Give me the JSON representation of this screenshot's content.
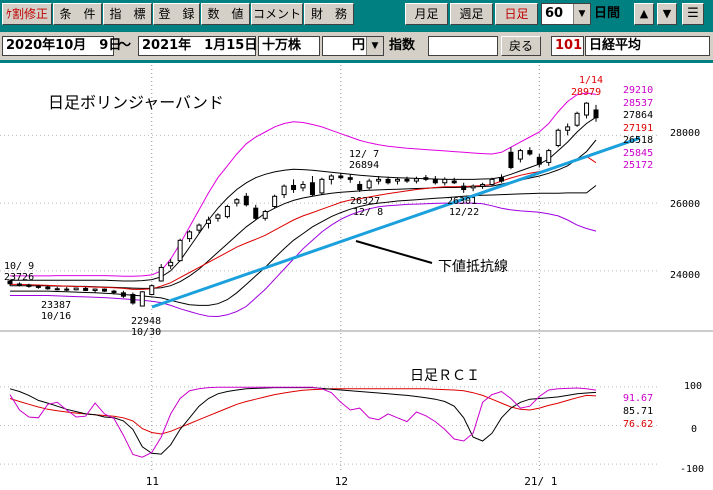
{
  "toolbar": {
    "buttons": [
      "ｹ割修正",
      "条　件",
      "指　標",
      "登　録",
      "数　値",
      "コメント",
      "財　務",
      "月足",
      "週足",
      "日足"
    ],
    "period_value": "60",
    "period_label": "日間",
    "arrow_up": "▲",
    "arrow_down": "▼",
    "menu": "☰"
  },
  "range_bar": {
    "start_date": "2020年10月　9日",
    "tilde": "～",
    "end_date": "2021年　1月15日",
    "unit": "十万株",
    "currency": "円",
    "index_label": "指数",
    "back_button": "戻る",
    "code": "101",
    "name": "日経平均"
  },
  "colors": {
    "upper": "#e000e0",
    "lower": "#a000e0",
    "sma": "#000000",
    "ema": "#dd0000",
    "trend": "#1aa0dc",
    "rci_long": "#dd0000",
    "rci_mid": "#000000",
    "rci_short": "#cc00cc"
  },
  "chart_data": [
    {
      "type": "candlestick",
      "title": "日足ボリンジャーバンド",
      "yticks": [
        24000,
        26000,
        28000
      ],
      "ylim": [
        22400,
        29900
      ],
      "xticks": [
        {
          "label": "11",
          "index": 15
        },
        {
          "label": "12",
          "index": 35
        },
        {
          "label": "21/ 1",
          "index": 56
        }
      ],
      "candles": [
        {
          "o": 23700,
          "h": 23740,
          "l": 23560,
          "c": 23620
        },
        {
          "o": 23610,
          "h": 23660,
          "l": 23540,
          "c": 23580
        },
        {
          "o": 23580,
          "h": 23620,
          "l": 23500,
          "c": 23540
        },
        {
          "o": 23540,
          "h": 23580,
          "l": 23470,
          "c": 23510
        },
        {
          "o": 23520,
          "h": 23560,
          "l": 23440,
          "c": 23470
        },
        {
          "o": 23470,
          "h": 23520,
          "l": 23420,
          "c": 23450
        },
        {
          "o": 23460,
          "h": 23520,
          "l": 23400,
          "c": 23430
        },
        {
          "o": 23440,
          "h": 23500,
          "l": 23420,
          "c": 23490
        },
        {
          "o": 23480,
          "h": 23520,
          "l": 23400,
          "c": 23420
        },
        {
          "o": 23420,
          "h": 23480,
          "l": 23360,
          "c": 23460
        },
        {
          "o": 23460,
          "h": 23480,
          "l": 23380,
          "c": 23400
        },
        {
          "o": 23400,
          "h": 23440,
          "l": 23300,
          "c": 23360
        },
        {
          "o": 23350,
          "h": 23410,
          "l": 23200,
          "c": 23250
        },
        {
          "o": 23300,
          "h": 23360,
          "l": 23000,
          "c": 23050
        },
        {
          "o": 22960,
          "h": 23400,
          "l": 22948,
          "c": 23380
        },
        {
          "o": 23300,
          "h": 23600,
          "l": 23280,
          "c": 23560
        },
        {
          "o": 23700,
          "h": 24200,
          "l": 23680,
          "c": 24100
        },
        {
          "o": 24150,
          "h": 24350,
          "l": 24050,
          "c": 24250
        },
        {
          "o": 24300,
          "h": 24950,
          "l": 24280,
          "c": 24900
        },
        {
          "o": 24950,
          "h": 25200,
          "l": 24850,
          "c": 25150
        },
        {
          "o": 25200,
          "h": 25400,
          "l": 25100,
          "c": 25350
        },
        {
          "o": 25400,
          "h": 25600,
          "l": 25250,
          "c": 25500
        },
        {
          "o": 25550,
          "h": 25700,
          "l": 25450,
          "c": 25650
        },
        {
          "o": 25600,
          "h": 25950,
          "l": 25550,
          "c": 25900
        },
        {
          "o": 26000,
          "h": 26150,
          "l": 25900,
          "c": 26100
        },
        {
          "o": 26200,
          "h": 26300,
          "l": 25900,
          "c": 25950
        },
        {
          "o": 25850,
          "h": 25950,
          "l": 25500,
          "c": 25550
        },
        {
          "o": 25550,
          "h": 25800,
          "l": 25480,
          "c": 25750
        },
        {
          "o": 25900,
          "h": 26250,
          "l": 25850,
          "c": 26200
        },
        {
          "o": 26250,
          "h": 26550,
          "l": 26150,
          "c": 26500
        },
        {
          "o": 26520,
          "h": 26700,
          "l": 26300,
          "c": 26400
        },
        {
          "o": 26450,
          "h": 26650,
          "l": 26350,
          "c": 26550
        },
        {
          "o": 26600,
          "h": 26800,
          "l": 26200,
          "c": 26250
        },
        {
          "o": 26300,
          "h": 26750,
          "l": 26250,
          "c": 26700
        },
        {
          "o": 26700,
          "h": 26850,
          "l": 26550,
          "c": 26800
        },
        {
          "o": 26800,
          "h": 26894,
          "l": 26700,
          "c": 26750
        },
        {
          "o": 26750,
          "h": 26850,
          "l": 26600,
          "c": 26700
        },
        {
          "o": 26550,
          "h": 26650,
          "l": 26327,
          "c": 26400
        },
        {
          "o": 26450,
          "h": 26720,
          "l": 26400,
          "c": 26650
        },
        {
          "o": 26650,
          "h": 26800,
          "l": 26550,
          "c": 26700
        },
        {
          "o": 26700,
          "h": 26780,
          "l": 26550,
          "c": 26600
        },
        {
          "o": 26650,
          "h": 26750,
          "l": 26550,
          "c": 26700
        },
        {
          "o": 26700,
          "h": 26780,
          "l": 26600,
          "c": 26650
        },
        {
          "o": 26650,
          "h": 26780,
          "l": 26580,
          "c": 26720
        },
        {
          "o": 26750,
          "h": 26830,
          "l": 26650,
          "c": 26700
        },
        {
          "o": 26700,
          "h": 26800,
          "l": 26550,
          "c": 26600
        },
        {
          "o": 26600,
          "h": 26760,
          "l": 26520,
          "c": 26700
        },
        {
          "o": 26650,
          "h": 26750,
          "l": 26560,
          "c": 26600
        },
        {
          "o": 26500,
          "h": 26600,
          "l": 26301,
          "c": 26400
        },
        {
          "o": 26450,
          "h": 26550,
          "l": 26350,
          "c": 26500
        },
        {
          "o": 26500,
          "h": 26600,
          "l": 26420,
          "c": 26550
        },
        {
          "o": 26550,
          "h": 26750,
          "l": 26500,
          "c": 26700
        },
        {
          "o": 26750,
          "h": 26850,
          "l": 26600,
          "c": 26650
        },
        {
          "o": 27500,
          "h": 27650,
          "l": 27000,
          "c": 27050
        },
        {
          "o": 27300,
          "h": 27600,
          "l": 27200,
          "c": 27550
        },
        {
          "o": 27550,
          "h": 27650,
          "l": 27400,
          "c": 27450
        },
        {
          "o": 27350,
          "h": 27450,
          "l": 27050,
          "c": 27150
        },
        {
          "o": 27200,
          "h": 27600,
          "l": 27100,
          "c": 27550
        },
        {
          "o": 27700,
          "h": 28200,
          "l": 27650,
          "c": 28150
        },
        {
          "o": 28150,
          "h": 28350,
          "l": 28000,
          "c": 28250
        },
        {
          "o": 28300,
          "h": 28700,
          "l": 28250,
          "c": 28650
        },
        {
          "o": 28600,
          "h": 28979,
          "l": 28500,
          "c": 28950
        },
        {
          "o": 28750,
          "h": 28900,
          "l": 28400,
          "c": 28520
        }
      ],
      "upper_band_2s": [
        23850,
        23850,
        23850,
        23850,
        23850,
        23860,
        23860,
        23860,
        23860,
        23860,
        23860,
        23850,
        23840,
        23840,
        23850,
        23880,
        24000,
        24350,
        24800,
        25300,
        25800,
        26300,
        26750,
        27100,
        27450,
        27750,
        27950,
        28100,
        28250,
        28350,
        28400,
        28380,
        28320,
        28250,
        28150,
        28050,
        27950,
        27850,
        27780,
        27720,
        27680,
        27650,
        27620,
        27600,
        27580,
        27560,
        27540,
        27520,
        27500,
        27480,
        27460,
        27450,
        27500,
        27650,
        27800,
        27950,
        28100,
        28350,
        28700,
        29000,
        29200,
        29250,
        29210
      ],
      "upper_band_1s": [
        23720,
        23720,
        23720,
        23720,
        23720,
        23720,
        23720,
        23720,
        23720,
        23720,
        23720,
        23710,
        23700,
        23700,
        23710,
        23740,
        23820,
        24000,
        24300,
        24700,
        25100,
        25500,
        25850,
        26150,
        26400,
        26600,
        26750,
        26850,
        26920,
        26970,
        27000,
        26990,
        26970,
        26940,
        26910,
        26880,
        26850,
        26820,
        26800,
        26780,
        26760,
        26750,
        26740,
        26730,
        26720,
        26710,
        26700,
        26700,
        26700,
        26700,
        26710,
        26720,
        26760,
        26850,
        26950,
        27050,
        27150,
        27300,
        27550,
        27800,
        28100,
        28350,
        28537
      ],
      "sma": [
        23560,
        23560,
        23560,
        23560,
        23560,
        23550,
        23550,
        23540,
        23540,
        23530,
        23520,
        23510,
        23500,
        23490,
        23480,
        23480,
        23500,
        23560,
        23680,
        23850,
        24050,
        24300,
        24550,
        24800,
        25050,
        25300,
        25500,
        25700,
        25850,
        25980,
        26080,
        26150,
        26200,
        26250,
        26290,
        26320,
        26340,
        26360,
        26380,
        26390,
        26400,
        26410,
        26420,
        26430,
        26440,
        26450,
        26460,
        26460,
        26470,
        26480,
        26490,
        26500,
        26560,
        26620,
        26680,
        26740,
        26800,
        26880,
        26980,
        27100,
        27300,
        27520,
        27864
      ],
      "ema": [
        23600,
        23600,
        23590,
        23580,
        23570,
        23560,
        23550,
        23540,
        23530,
        23520,
        23510,
        23500,
        23480,
        23450,
        23450,
        23470,
        23550,
        23650,
        23800,
        23950,
        24100,
        24250,
        24400,
        24550,
        24700,
        24820,
        24930,
        25050,
        25200,
        25350,
        25500,
        25620,
        25720,
        25820,
        25920,
        26020,
        26090,
        26130,
        26180,
        26230,
        26280,
        26320,
        26360,
        26400,
        26430,
        26460,
        26480,
        26480,
        26490,
        26500,
        26520,
        26550,
        26650,
        26740,
        26820,
        26880,
        26930,
        27000,
        27080,
        27180,
        27280,
        27380,
        27191
      ],
      "lower_band_1s": [
        23400,
        23400,
        23400,
        23400,
        23400,
        23390,
        23380,
        23370,
        23360,
        23350,
        23340,
        23320,
        23300,
        23280,
        23260,
        23230,
        23200,
        23130,
        23060,
        23000,
        22980,
        22980,
        23030,
        23150,
        23350,
        23600,
        23850,
        24100,
        24380,
        24650,
        24900,
        25100,
        25300,
        25450,
        25600,
        25720,
        25820,
        25900,
        25960,
        26000,
        26030,
        26060,
        26080,
        26100,
        26120,
        26140,
        26160,
        26180,
        26200,
        26220,
        26230,
        26240,
        26250,
        26260,
        26270,
        26280,
        26290,
        26290,
        26290,
        26300,
        26300,
        26300,
        26518
      ],
      "lower_band_2s": [
        23270,
        23270,
        23270,
        23270,
        23270,
        23260,
        23250,
        23240,
        23230,
        23220,
        23210,
        23190,
        23170,
        23150,
        23130,
        23100,
        23060,
        22980,
        22880,
        22800,
        22720,
        22660,
        22650,
        22700,
        22800,
        22950,
        23200,
        23450,
        23750,
        24050,
        24350,
        24650,
        24900,
        25150,
        25350,
        25520,
        25650,
        25750,
        25830,
        25890,
        25920,
        25940,
        25960,
        25970,
        25980,
        25990,
        26000,
        26000,
        26000,
        26000,
        25980,
        25920,
        25850,
        25800,
        25770,
        25750,
        25730,
        25680,
        25620,
        25500,
        25350,
        25250,
        25172
      ]
    },
    {
      "type": "line",
      "title": "日足ＲＣＩ",
      "yticks": [
        100,
        0,
        -100
      ],
      "ylim": [
        -110,
        110
      ],
      "series": [
        {
          "values": [
            70,
            62,
            55,
            48,
            42,
            38,
            35,
            32,
            30,
            28,
            26,
            24,
            20,
            12,
            -8,
            -18,
            -22,
            -15,
            -5,
            5,
            15,
            25,
            35,
            45,
            55,
            62,
            68,
            74,
            80,
            84,
            88,
            91,
            93,
            94,
            95,
            95,
            95,
            95,
            95,
            95,
            95,
            95,
            95,
            95,
            95,
            94,
            93,
            92,
            90,
            85,
            78,
            68,
            58,
            48,
            42,
            40,
            45,
            52,
            58,
            65,
            72,
            78,
            76.62
          ]
        },
        {
          "values": [
            95,
            88,
            78,
            65,
            58,
            50,
            42,
            36,
            30,
            28,
            22,
            20,
            12,
            -10,
            -55,
            -72,
            -74,
            -50,
            -10,
            20,
            50,
            70,
            82,
            88,
            92,
            95,
            96,
            97,
            98,
            98,
            98,
            98,
            98,
            96,
            94,
            92,
            90,
            88,
            86,
            84,
            82,
            80,
            78,
            75,
            72,
            68,
            62,
            50,
            20,
            -30,
            -40,
            -20,
            20,
            45,
            60,
            68,
            70,
            72,
            74,
            78,
            82,
            84,
            85.71
          ]
        },
        {
          "values": [
            80,
            40,
            22,
            20,
            55,
            60,
            40,
            22,
            24,
            58,
            30,
            18,
            -25,
            -75,
            -82,
            -70,
            -30,
            30,
            70,
            90,
            95,
            98,
            99,
            99,
            99,
            99,
            99,
            99,
            99,
            99,
            99,
            99,
            99,
            95,
            85,
            60,
            40,
            45,
            20,
            15,
            30,
            20,
            10,
            35,
            25,
            10,
            -10,
            -35,
            -40,
            -20,
            60,
            80,
            88,
            70,
            45,
            50,
            75,
            92,
            95,
            96,
            97,
            95,
            91.67
          ]
        }
      ]
    }
  ],
  "annotations": {
    "hi_date": "1/14",
    "hi_value": "28979",
    "left_start_date": "10/ 9",
    "left_start_value": "23726",
    "left_low_value": "23387",
    "left_low_date": "10/16",
    "oct_low_value": "22948",
    "oct_low_date": "10/30",
    "dec_high_date": "12/ 7",
    "dec_high_value": "26894",
    "dec_low_value": "26327",
    "dec_low_date": "12/ 8",
    "dec22_value": "26301",
    "dec22_date": "12/22",
    "support_label": "下値抵抗線",
    "band_values": [
      "29210",
      "28537",
      "27864",
      "27191",
      "26518",
      "25845",
      "25172"
    ],
    "rci_values": [
      "91.67",
      "85.71",
      "76.62"
    ],
    "y_tick_labels": [
      "28000",
      "26000",
      "24000"
    ],
    "rci_tick_labels": [
      "100",
      "0",
      "-100"
    ]
  }
}
